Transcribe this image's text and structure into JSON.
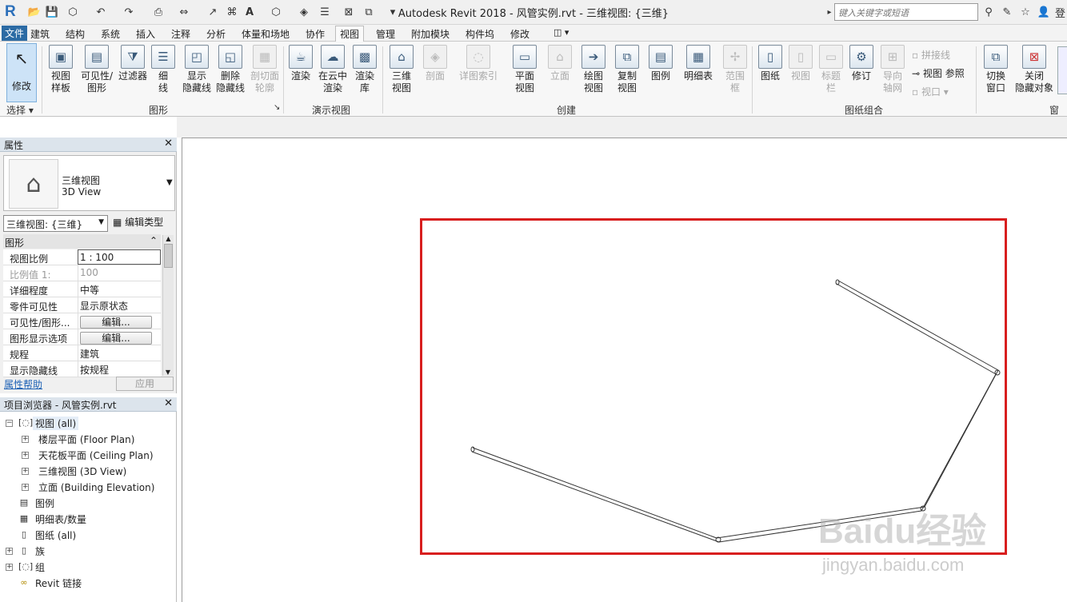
{
  "titlebar": {
    "app_title": "Autodesk Revit 2018 -    风管实例.rvt - 三维视图: {三维}",
    "search_placeholder": "键入关键字或短语",
    "right_partial": "登"
  },
  "tabs": [
    "文件",
    "建筑",
    "结构",
    "系统",
    "插入",
    "注释",
    "分析",
    "体量和场地",
    "协作",
    "视图",
    "管理",
    "附加模块",
    "构件坞",
    "修改"
  ],
  "active_tab": "视图",
  "ribbon": {
    "select": {
      "modify": "修改",
      "select_label": "选择 ▾"
    },
    "graphics": {
      "buttons": [
        "视图\n样板",
        "可见性/\n图形",
        "过滤器",
        "细\n线",
        "显示\n隐藏线",
        "删除\n隐藏线",
        "剖切面\n轮廓"
      ],
      "label": "图形"
    },
    "presentation": {
      "buttons": [
        "渲染",
        "在云中\n渲染",
        "渲染\n库"
      ],
      "label": "演示视图"
    },
    "create": {
      "buttons": [
        "三维\n视图",
        "剖面",
        "详图索引",
        "平面\n视图",
        "立面",
        "绘图\n视图",
        "复制\n视图",
        "图例",
        "明细表",
        "范围\n框"
      ],
      "label": "创建"
    },
    "sheet": {
      "buttons": [
        "图纸",
        "视图",
        "标题\n栏",
        "修订",
        "导向\n轴网"
      ],
      "small": [
        "拼接线",
        "视图 参照",
        "视口 ▾"
      ],
      "label": "图纸组合"
    },
    "windows": {
      "buttons": [
        "切换\n窗口",
        "关闭\n隐藏对象"
      ],
      "label": "窗口"
    }
  },
  "properties": {
    "title": "属性",
    "type_name": "三维视图",
    "type_name_en": "3D View",
    "selector": "三维视图: {三维}",
    "edit_type": "编辑类型",
    "group": "图形",
    "rows": [
      {
        "k": "视图比例",
        "v": "1 : 100"
      },
      {
        "k": "比例值 1:",
        "v": "100"
      },
      {
        "k": "详细程度",
        "v": "中等"
      },
      {
        "k": "零件可见性",
        "v": "显示原状态"
      },
      {
        "k": "可见性/图形...",
        "v": "编辑..."
      },
      {
        "k": "图形显示选项",
        "v": "编辑..."
      },
      {
        "k": "规程",
        "v": "建筑"
      },
      {
        "k": "显示隐藏线",
        "v": "按规程"
      }
    ],
    "help": "属性帮助",
    "apply": "应用"
  },
  "browser": {
    "title": "项目浏览器 - 风管实例.rvt",
    "root": "视图 (all)",
    "views": [
      "楼层平面 (Floor Plan)",
      "天花板平面 (Ceiling Plan)",
      "三维视图 (3D View)",
      "立面 (Building Elevation)"
    ],
    "others": [
      "图例",
      "明细表/数量",
      "图纸 (all)",
      "族",
      "组",
      "Revit 链接"
    ]
  },
  "canvas": {
    "watermark": "Baidu经验",
    "watermark_url": "jingyan.baidu.com",
    "highlight_color": "#d81e1e"
  }
}
